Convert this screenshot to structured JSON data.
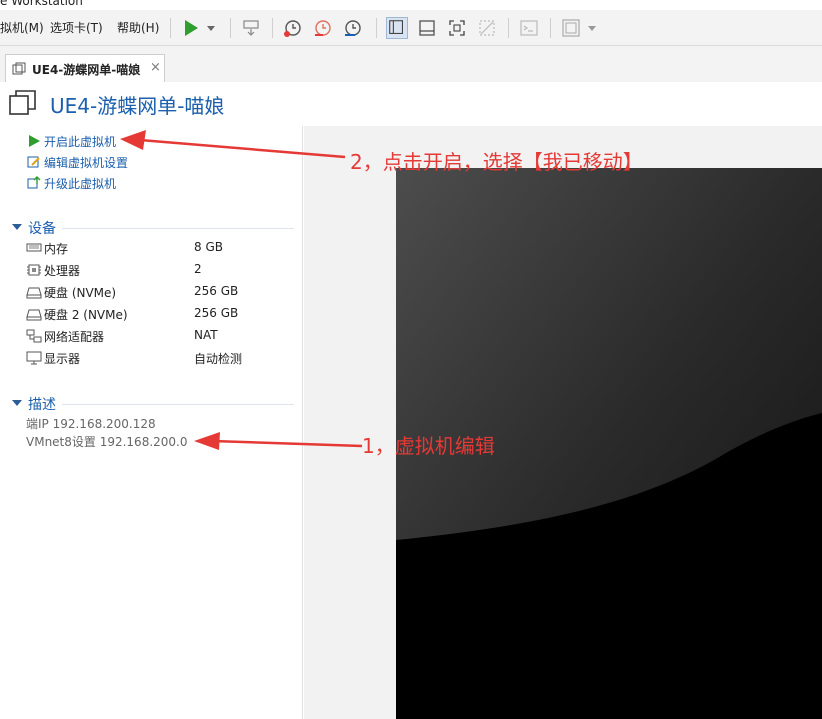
{
  "window": {
    "title_fragment": "e Workstation"
  },
  "menu": [
    {
      "label": "虚拟机(M)"
    },
    {
      "label": "选项卡(T)"
    },
    {
      "label": "帮助(H)"
    }
  ],
  "menu_display": [
    "拟机(M)",
    "选项卡(T)",
    "帮助(H)"
  ],
  "tab": {
    "label": "UE4-游蝶网单-喵娘",
    "close": "×"
  },
  "vm": {
    "title": "UE4-游蝶网单-喵娘"
  },
  "actions": [
    {
      "label": "开启此虚拟机",
      "icon": "play-icon"
    },
    {
      "label": "编辑虚拟机设置",
      "icon": "edit-icon"
    },
    {
      "label": "升级此虚拟机",
      "icon": "upgrade-icon"
    }
  ],
  "devices": {
    "heading": "设备",
    "items": [
      {
        "name": "内存",
        "value": "8 GB",
        "icon": "memory-icon"
      },
      {
        "name": "处理器",
        "value": "2",
        "icon": "cpu-icon"
      },
      {
        "name": "硬盘 (NVMe)",
        "value": "256 GB",
        "icon": "disk-icon"
      },
      {
        "name": "硬盘 2 (NVMe)",
        "value": "256 GB",
        "icon": "disk-icon"
      },
      {
        "name": "网络适配器",
        "value": "NAT",
        "icon": "network-icon"
      },
      {
        "name": "显示器",
        "value": "自动检测",
        "icon": "monitor-icon"
      }
    ]
  },
  "description": {
    "heading": "描述",
    "lines": [
      "端IP 192.168.200.128",
      "VMnet8设置 192.168.200.0"
    ]
  },
  "annotations": {
    "step2": "2，点击开启，选择【我已移动】",
    "step1": "1，虚拟机编辑"
  },
  "colors": {
    "link": "#1b5fae",
    "annotation": "#e53935",
    "play": "#2e9e2e"
  }
}
